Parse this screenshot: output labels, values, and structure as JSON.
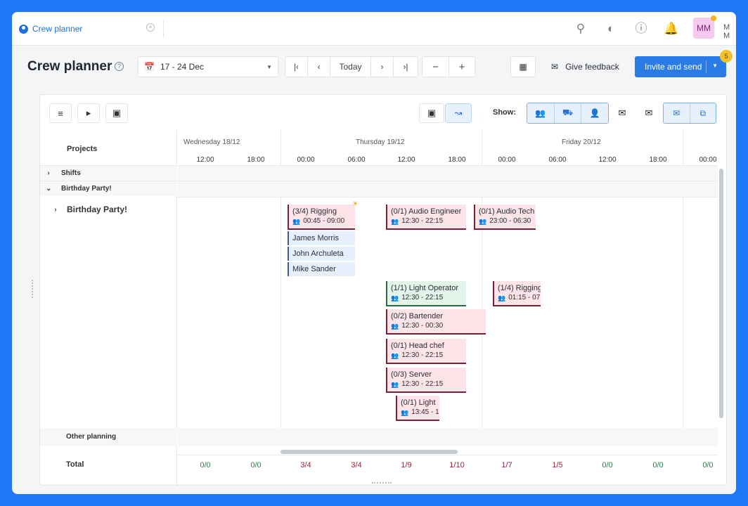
{
  "tab": {
    "label": "Crew planner"
  },
  "user": {
    "initials": "MM",
    "name": "M M"
  },
  "header": {
    "title": "Crew planner",
    "date_range": "17 - 24 Dec",
    "today_label": "Today",
    "feedback_label": "Give feedback",
    "invite_label": "Invite and send",
    "invite_badge": "5"
  },
  "toolbar": {
    "show_label": "Show:"
  },
  "left": {
    "projects_header": "Projects",
    "rows": [
      "Shifts",
      "Birthday Party!"
    ],
    "project_name": "Birthday Party!",
    "other_planning": "Other planning",
    "total_label": "Total"
  },
  "timeline": {
    "days": [
      "Wednesday 18/12",
      "Thursday 19/12",
      "Friday 20/12"
    ],
    "hours": [
      "12:00",
      "18:00",
      "00:00",
      "06:00",
      "12:00",
      "18:00",
      "00:00",
      "06:00",
      "12:00",
      "18:00",
      "00:00"
    ]
  },
  "cards": [
    {
      "title": "(3/4) Rigging",
      "time": "00:45 - 09:00",
      "color": "red"
    },
    {
      "title": "(0/1) Audio Engineer",
      "time": "12:30 - 22:15",
      "color": "red"
    },
    {
      "title": "(0/1) Audio Tech",
      "time": "23:00 - 06:30",
      "color": "red"
    },
    {
      "title": "(1/1) Light Operator",
      "time": "12:30 - 22:15",
      "color": "green"
    },
    {
      "title": "(1/4) Rigging",
      "time": "01:15 - 07",
      "color": "red"
    },
    {
      "title": "(0/2) Bartender",
      "time": "12:30 - 00:30",
      "color": "red"
    },
    {
      "title": "(0/1) Head chef",
      "time": "12:30 - 22:15",
      "color": "red"
    },
    {
      "title": "(0/3) Server",
      "time": "12:30 - 22:15",
      "color": "red"
    },
    {
      "title": "(0/1) Light",
      "time": "13:45 - 1",
      "color": "red"
    }
  ],
  "people": [
    "James Morris",
    "John Archuleta",
    "Mike Sander"
  ],
  "totals": [
    "0/0",
    "0/0",
    "3/4",
    "3/4",
    "1/9",
    "1/10",
    "1/7",
    "1/5",
    "0/0",
    "0/0",
    "0/0"
  ],
  "colors": {
    "accent": "#2b7be6",
    "card_red_bg": "#fce4e8",
    "card_red_border": "#7a1f33",
    "card_green_bg": "#e3f5ea",
    "frame": "#1e78f5"
  }
}
